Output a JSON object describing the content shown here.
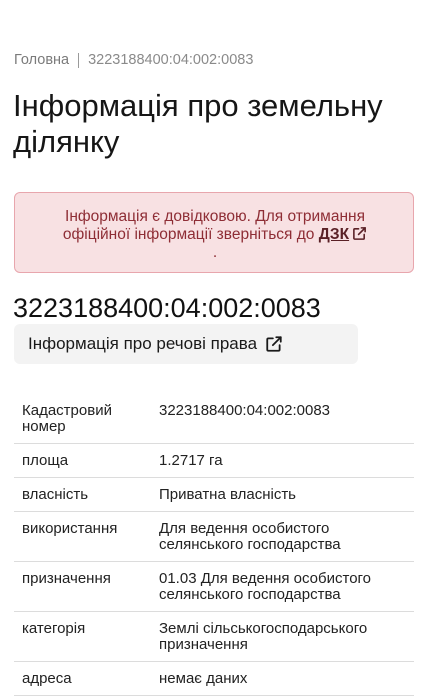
{
  "breadcrumb": {
    "home": "Головна",
    "current": "3223188400:04:002:0083"
  },
  "page_title": "Інформація про земельну ділянку",
  "alert": {
    "text": "Інформація є довідковою. Для отримання офіційної інформації зверніться до",
    "link_label": "ДЗК",
    "trailing": "."
  },
  "cadastral_heading": "3223188400:04:002:0083",
  "rights_button": {
    "label": "Інформація про речові права"
  },
  "table": {
    "rows": [
      {
        "key": "Кадастровий номер",
        "value": "3223188400:04:002:0083"
      },
      {
        "key": "площа",
        "value": "1.2717 га"
      },
      {
        "key": "власність",
        "value": "Приватна власність"
      },
      {
        "key": "використання",
        "value": "Для ведення особистого селянського господарства"
      },
      {
        "key": "призначення",
        "value": "01.03 Для ведення особистого селянського господарства"
      },
      {
        "key": "категорія",
        "value": "Землі сільськогосподарського призначення"
      },
      {
        "key": "адреса",
        "value": "немає даних"
      }
    ]
  }
}
